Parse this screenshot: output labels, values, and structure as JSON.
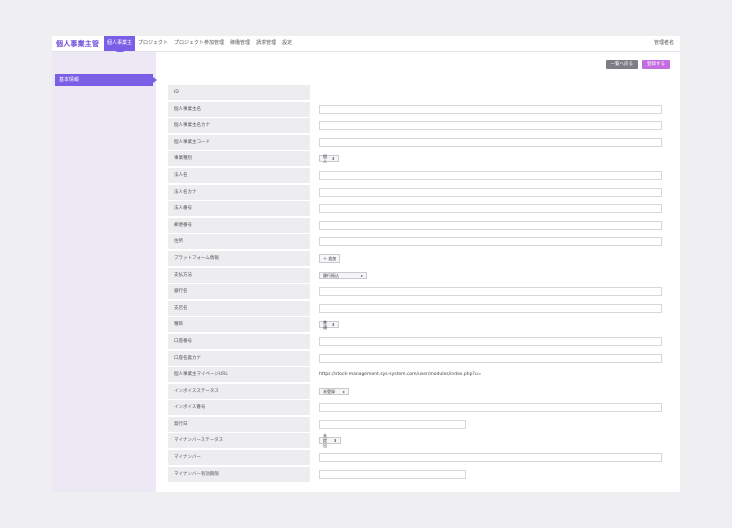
{
  "app": {
    "brand": "個人事業主管"
  },
  "nav": [
    {
      "label": "個人事業主",
      "active": true
    },
    {
      "label": "プロジェクト",
      "active": false
    },
    {
      "label": "プロジェクト参加管理",
      "active": false
    },
    {
      "label": "稼働管理",
      "active": false
    },
    {
      "label": "請求管理",
      "active": false
    },
    {
      "label": "設定",
      "active": false
    }
  ],
  "user": {
    "name": "管理者名"
  },
  "sidebar": {
    "items": [
      {
        "label": "基本情報"
      }
    ]
  },
  "actions": {
    "back_label": "一覧へ戻る",
    "save_label": "登録する"
  },
  "form": {
    "id_label": "ID",
    "name_label": "個人事業主名",
    "name_kana_label": "個人事業主名カナ",
    "code_label": "個人事業主コード",
    "type_label": "事業種別",
    "type_value": "個人",
    "corp_name_label": "法人名",
    "corp_kana_label": "法人名カナ",
    "corp_number_label": "法人番号",
    "postal_label": "郵便番号",
    "address_label": "住所",
    "platform_label": "プラットフォーム情報",
    "platform_button": "＋ 追加",
    "payment_label": "支払方法",
    "payment_value": "銀行振込",
    "bank_label": "銀行名",
    "branch_label": "支店名",
    "account_type_label": "種目",
    "account_type_value": "普通",
    "account_number_label": "口座番号",
    "holder_kana_label": "口座名義カナ",
    "mypage_label": "個人事業主マイページURL",
    "mypage_url": "https://stock-management.sys-system.com/user/modules/index.php?u=",
    "invoice_status_label": "インボイスステータス",
    "invoice_status_value": "未登録",
    "invoice_number_label": "インボイス番号",
    "issue_date_label": "発行日",
    "mynumber_status_label": "マイナンバーステータス",
    "mynumber_status_value": "未提出",
    "mynumber_label": "マイナンバー",
    "mynumber_expiry_label": "マイナンバー有効期限"
  }
}
